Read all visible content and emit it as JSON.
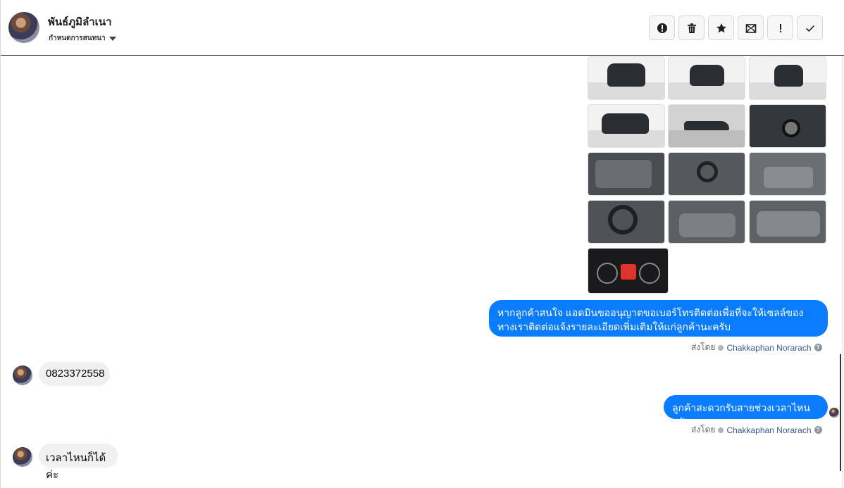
{
  "header": {
    "contact_name": "พันธ์ภูมิลำเนา",
    "assign_label": "กำหนดการสนทนา",
    "actions": [
      {
        "name": "spam-button",
        "icon": "alert-circle-icon"
      },
      {
        "name": "delete-button",
        "icon": "trash-icon"
      },
      {
        "name": "star-button",
        "icon": "star-icon"
      },
      {
        "name": "mark-unread-button",
        "icon": "envelope-icon"
      },
      {
        "name": "important-button",
        "icon": "exclamation-icon"
      },
      {
        "name": "done-button",
        "icon": "check-icon"
      }
    ]
  },
  "messages": {
    "m1": {
      "text": "หากลูกค้าสนใจ แอดมินขออนุญาตขอเบอร์โทรติดต่อเพื่อที่จะให้เซลล์ของทางเราติดต่อแจ้งรายละเอียดเพิ่มเติมให้แก่ลูกค้านะครับ"
    },
    "m2": {
      "text": "0823372558"
    },
    "m3": {
      "text": "ลูกค้าสะดวกรับสายช่วงเวลาไหนครับ"
    },
    "m4": {
      "text": "เวลาไหนก็ได้ค่ะ"
    }
  },
  "sent_by": {
    "prefix": "ส่งโดย",
    "sender": "Chakkaphan Norarach",
    "help": "?"
  },
  "colors": {
    "outgoing_bubble": "#0a7cff",
    "incoming_bubble": "#f0f0f0",
    "sender_link": "#385898"
  }
}
